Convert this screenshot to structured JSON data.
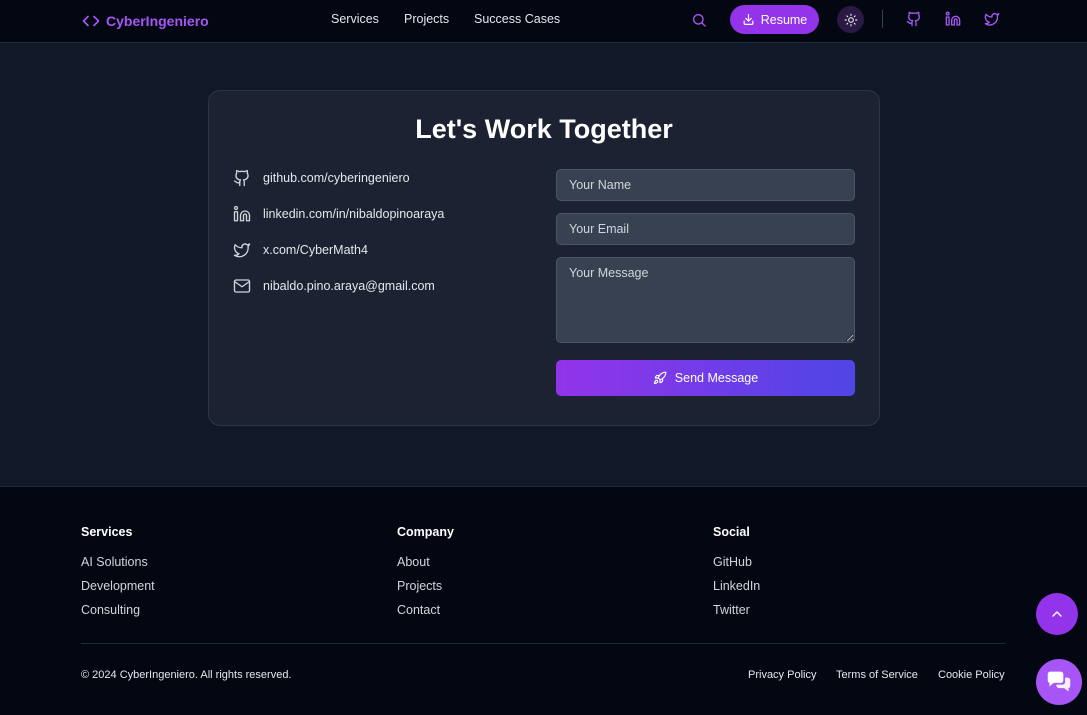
{
  "nav": {
    "brand": "CyberIngeniero",
    "links": [
      "Services",
      "Projects",
      "Success Cases"
    ],
    "resume_label": "Resume",
    "icons": [
      "search-icon",
      "download-icon",
      "sun-icon",
      "github-icon",
      "linkedin-icon",
      "twitter-icon"
    ]
  },
  "contact": {
    "title": "Let's Work Together",
    "items": [
      {
        "icon": "github-icon",
        "text": "github.com/cyberingeniero"
      },
      {
        "icon": "linkedin-icon",
        "text": "linkedin.com/in/nibaldopinoaraya"
      },
      {
        "icon": "twitter-icon",
        "text": "x.com/CyberMath4"
      },
      {
        "icon": "mail-icon",
        "text": "nibaldo.pino.araya@gmail.com"
      }
    ],
    "form": {
      "name_placeholder": "Your Name",
      "email_placeholder": "Your Email",
      "message_placeholder": "Your Message",
      "send_label": "Send Message"
    }
  },
  "footer": {
    "columns": [
      {
        "title": "Services",
        "links": [
          "AI Solutions",
          "Development",
          "Consulting"
        ]
      },
      {
        "title": "Company",
        "links": [
          "About",
          "Projects",
          "Contact"
        ]
      },
      {
        "title": "Social",
        "links": [
          "GitHub",
          "LinkedIn",
          "Twitter"
        ]
      }
    ],
    "copyright": "© 2024 CyberIngeniero. All rights reserved.",
    "legal": [
      "Privacy Policy",
      "Terms of Service",
      "Cookie Policy"
    ]
  },
  "colors": {
    "accent": "#a855f7",
    "accent_dark": "#9333ea",
    "gradient_end": "#4f46e5",
    "background": "#111827",
    "nav_bg": "#030712",
    "card_bg": "#1c2231"
  }
}
